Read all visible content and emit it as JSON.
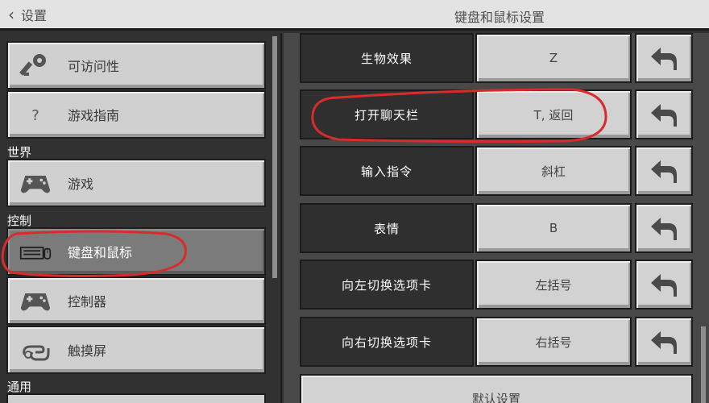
{
  "header": {
    "back_label": "设置",
    "title": "键盘和鼠标设置"
  },
  "sidebar": {
    "items": [
      {
        "label": "可访问性",
        "icon": "key-icon"
      },
      {
        "label": "游戏指南",
        "icon": "question-icon",
        "glyph": "?"
      },
      {
        "label": "游戏",
        "icon": "gamepad-icon"
      },
      {
        "label": "键盘和鼠标",
        "icon": "keyboard-mouse-icon",
        "selected": true
      },
      {
        "label": "控制器",
        "icon": "gamepad-icon"
      },
      {
        "label": "触摸屏",
        "icon": "touch-hand-icon"
      }
    ],
    "sections": {
      "world": "世界",
      "controls": "控制",
      "general": "通用"
    }
  },
  "bindings": [
    {
      "action": "生物效果",
      "key": "Z"
    },
    {
      "action": "打开聊天栏",
      "key": "T, 返回"
    },
    {
      "action": "输入指令",
      "key": "斜杠"
    },
    {
      "action": "表情",
      "key": "B"
    },
    {
      "action": "向左切换选项卡",
      "key": "左括号"
    },
    {
      "action": "向右切换选项卡",
      "key": "右括号"
    }
  ],
  "reset_icon": "undo-arrow-icon",
  "default_button_label": "默认设置",
  "colors": {
    "annotation": "#d92b2b",
    "selected_item": "#7b7b7b",
    "button": "#d2d2d2"
  }
}
